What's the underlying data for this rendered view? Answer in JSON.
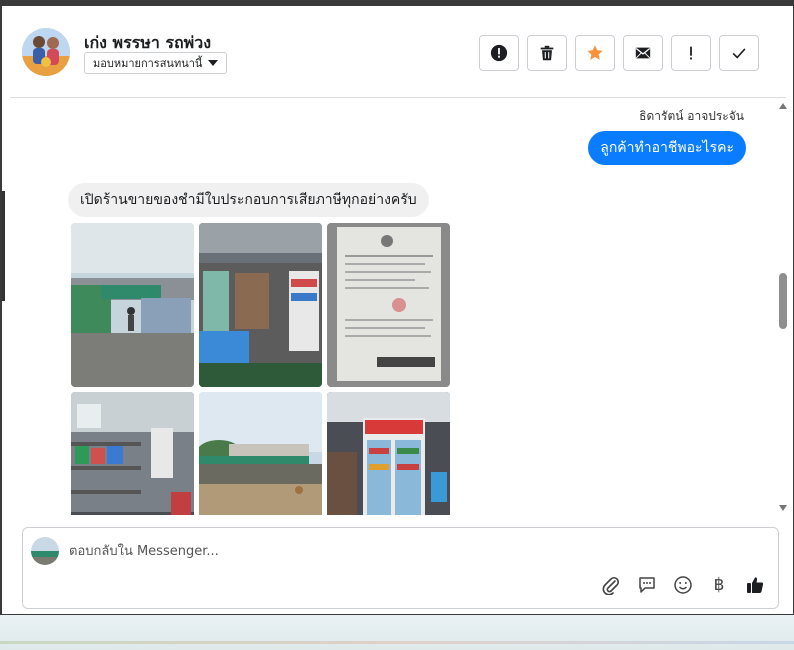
{
  "header": {
    "contact_name": "เก่ง พรรษา รถพ่วง",
    "assign_label": "มอบหมายการสนทนานี้",
    "toolbar": {
      "items": [
        {
          "name": "mark-spam-button",
          "icon": "alert-circle-icon"
        },
        {
          "name": "delete-button",
          "icon": "trash-icon"
        },
        {
          "name": "star-button",
          "icon": "star-icon",
          "color": "#f7923b"
        },
        {
          "name": "mark-unread-button",
          "icon": "envelope-icon"
        },
        {
          "name": "follow-up-button",
          "icon": "exclamation-icon"
        },
        {
          "name": "done-button",
          "icon": "check-icon"
        }
      ]
    }
  },
  "chat": {
    "sender_name": "ธิดารัตน์ อาจประจัน",
    "outgoing_message": "ลูกค้าทำอาชีพอะไรคะ",
    "incoming_message": "เปิดร้านขายของชำมีใบประกอบการเสียภาษีทุกอย่างครับ",
    "photos": [
      {
        "name": "photo-shop-exterior"
      },
      {
        "name": "photo-shop-interior"
      },
      {
        "name": "photo-tax-document"
      },
      {
        "name": "photo-shelves"
      },
      {
        "name": "photo-roadside-shop"
      },
      {
        "name": "photo-fridge"
      }
    ],
    "accent_color": "#0a7cff"
  },
  "composer": {
    "placeholder": "ตอบกลับใน Messenger...",
    "currency_symbol": "฿",
    "tools": [
      "paperclip-icon",
      "speech-bubble-icon",
      "smiley-icon",
      "baht-icon",
      "thumbs-up-icon"
    ]
  }
}
